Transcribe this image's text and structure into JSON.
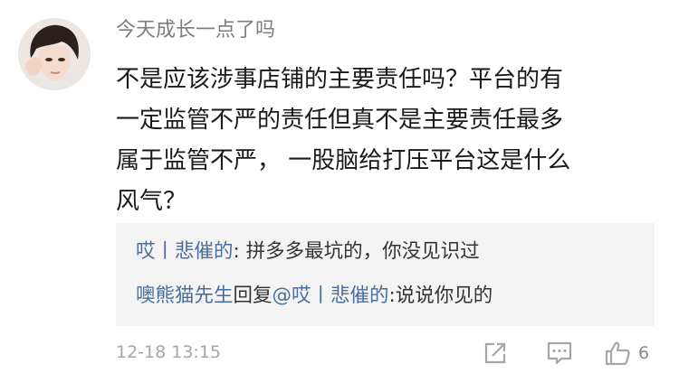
{
  "comment": {
    "username": "今天成长一点了吗",
    "lines": [
      "不是应该涉事店铺的主要责任吗？平台的有",
      "一定监管不严的责任但真不是主要责任最多",
      "属于监管不严，  一股脑给打压平台这是什么",
      "风气？"
    ],
    "time": "12-18 13:15",
    "like_count": "6"
  },
  "replies": [
    {
      "author": "哎丨悲催的",
      "sep": ": ",
      "text": "拼多多最坑的，你没见识过"
    },
    {
      "author": "噢熊猫先生",
      "mid": "回复",
      "target": "@哎丨悲催的",
      "sep": ":",
      "text": "说说你见的"
    }
  ],
  "icons": {
    "share": "share-icon",
    "comment": "comment-icon",
    "like": "thumbs-up-icon"
  },
  "colors": {
    "username": "#7d7d7d",
    "link": "#4a6d99",
    "reply_bg": "#f4f4f4",
    "meta": "#a6a6a6"
  }
}
